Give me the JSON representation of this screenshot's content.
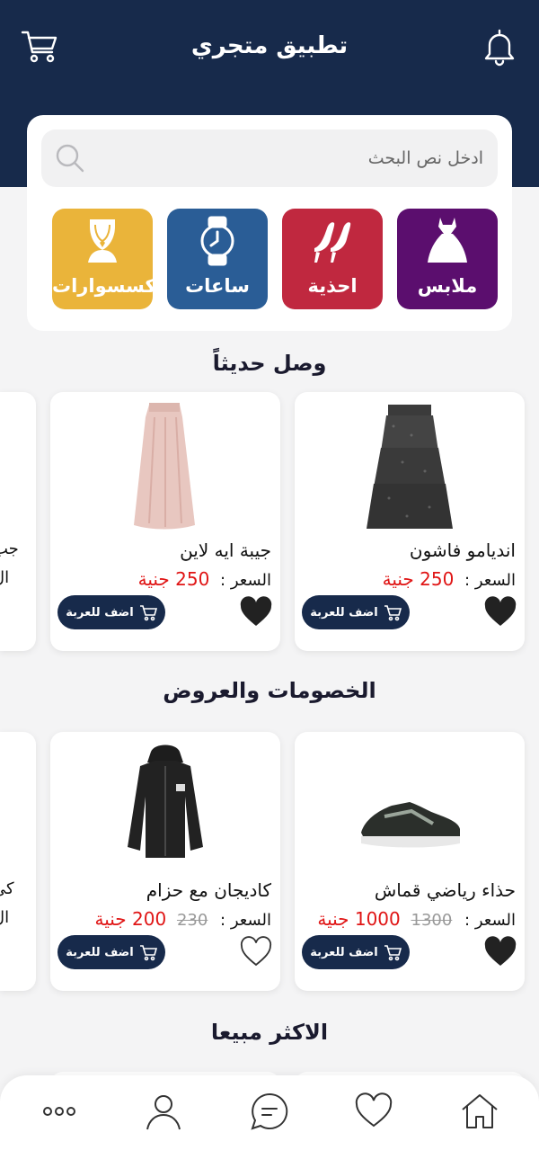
{
  "header": {
    "title": "تطبيق متجري",
    "left_icon": "cart-icon",
    "right_icon": "bell-icon",
    "bg_color": "#172a4b"
  },
  "search": {
    "placeholder": "ادخل نص البحث",
    "icon": "search-icon"
  },
  "categories": [
    {
      "label": "ملابس",
      "icon": "dress-icon",
      "color": "#5b0e6e"
    },
    {
      "label": "احذية",
      "icon": "heels-icon",
      "color": "#c0283f"
    },
    {
      "label": "ساعات",
      "icon": "watch-icon",
      "color": "#2a5d96"
    },
    {
      "label": "اكسسوارات",
      "icon": "necklace-icon",
      "color": "#eab43a"
    }
  ],
  "sections": {
    "new_arrivals": "وصل حديثاً",
    "discounts": "الخصومات والعروض",
    "best_sellers": "الاكثر مبيعا"
  },
  "price_label": "السعر :",
  "add_to_cart": "اضف للعربة",
  "new_arrivals": [
    {
      "name": "انديامو فاشون",
      "price": "250 جنية",
      "favorite": true,
      "image": "black-tiered-skirt"
    },
    {
      "name": "جيبة ايه لاين",
      "price": "250 جنية",
      "favorite": true,
      "image": "pink-maxi-skirt"
    }
  ],
  "new_arrivals_partial": {
    "name_fragment": "جب",
    "price_fragment": "ال"
  },
  "discounts": [
    {
      "name": "حذاء رياضي قماش",
      "old_price": "1300",
      "price": "1000 جنية",
      "favorite": true,
      "image": "sneaker"
    },
    {
      "name": "كاديجان مع حزام",
      "old_price": "230",
      "price": "200 جنية",
      "favorite": false,
      "image": "black-hoodie"
    }
  ],
  "discounts_partial": {
    "name_fragment": "كي",
    "price_fragment": "ال"
  },
  "bottom_nav": [
    {
      "icon": "home-icon"
    },
    {
      "icon": "heart-icon"
    },
    {
      "icon": "chat-icon"
    },
    {
      "icon": "profile-icon"
    },
    {
      "icon": "more-icon"
    }
  ],
  "colors": {
    "accent": "#172a4b",
    "price_red": "#e01515",
    "background": "#f4f4f5"
  }
}
